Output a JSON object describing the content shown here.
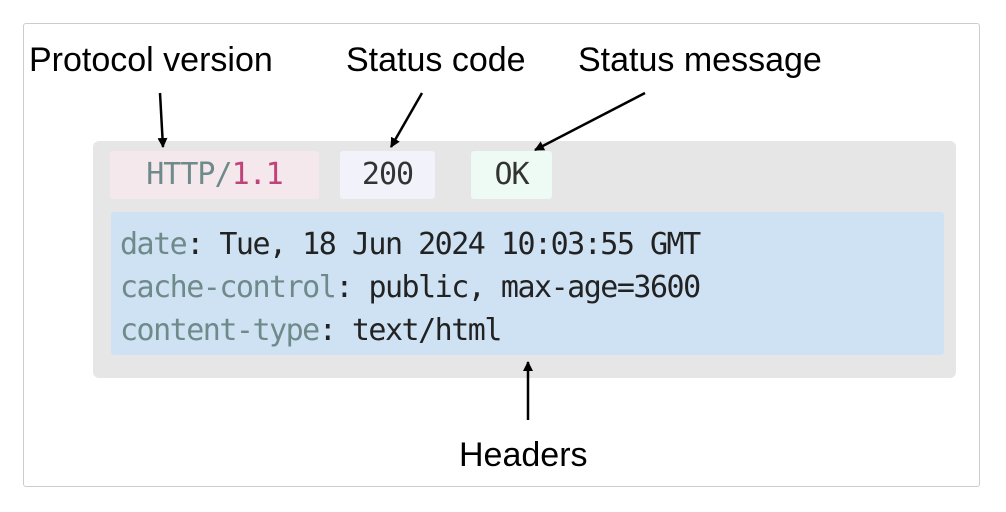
{
  "annotations": {
    "protocol": "Protocol version",
    "status_code": "Status code",
    "status_message": "Status message",
    "headers": "Headers"
  },
  "status_line": {
    "protocol_name": "HTTP/",
    "protocol_version": "1.1",
    "code": "200",
    "message": "OK"
  },
  "headers": [
    {
      "key": "date",
      "sep": ": ",
      "value": "Tue, 18 Jun 2024 10:03:55 GMT"
    },
    {
      "key": "cache-control",
      "sep": ": ",
      "value": "public, max-age=3600"
    },
    {
      "key": "content-type",
      "sep": ": ",
      "value": "text/html"
    }
  ]
}
